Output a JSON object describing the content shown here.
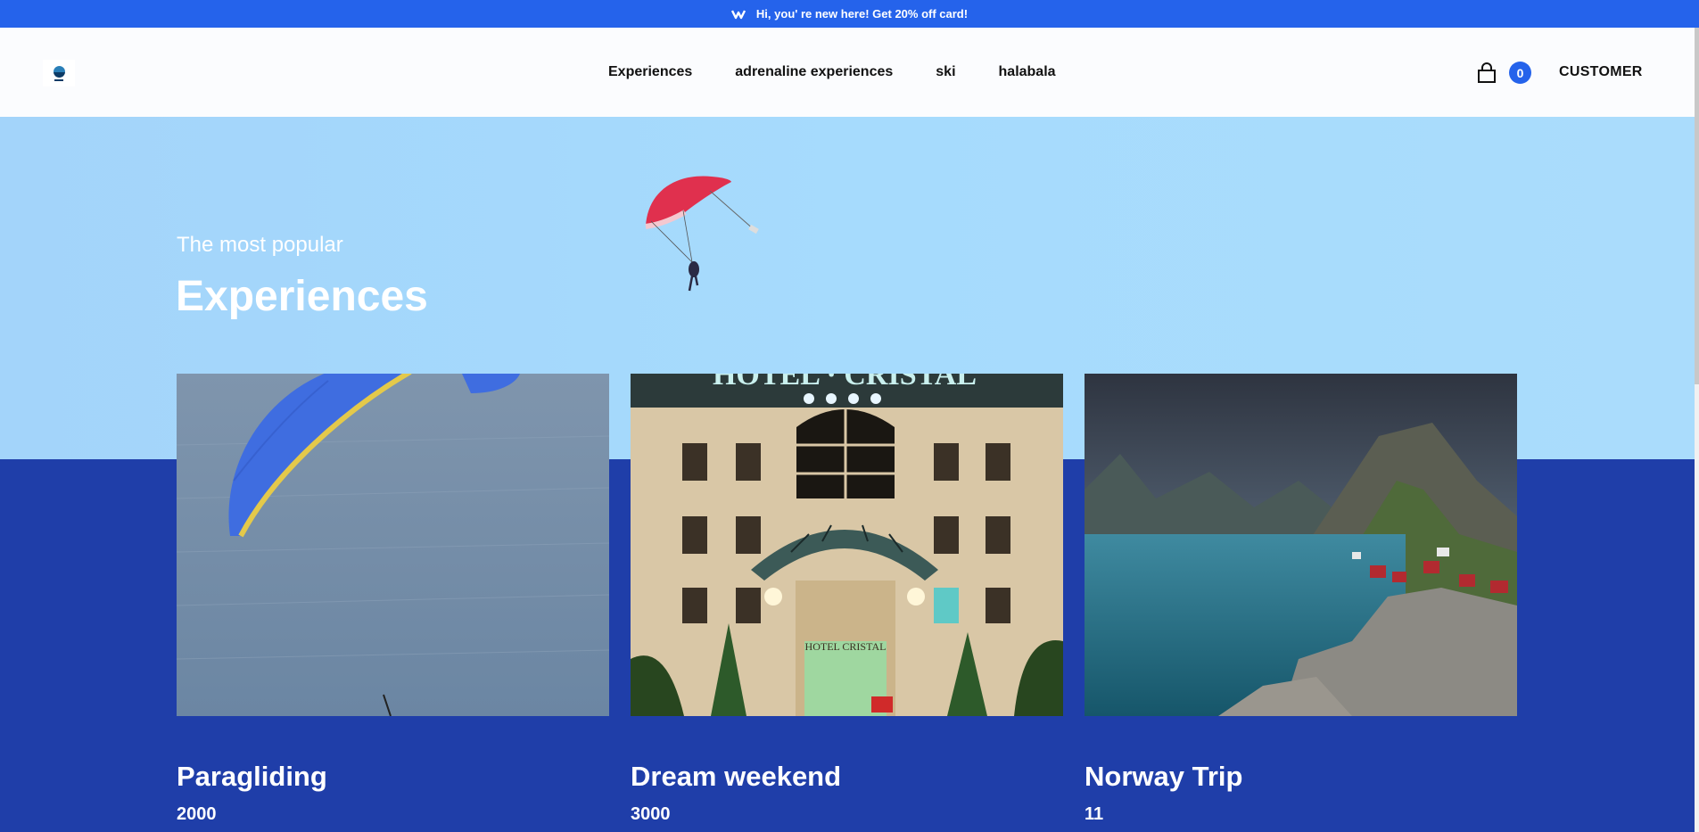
{
  "announcement": {
    "text": "Hi, you' re new here! Get 20% off card!"
  },
  "nav": {
    "items": [
      {
        "label": "Experiences"
      },
      {
        "label": "adrenaline experiences"
      },
      {
        "label": "ski"
      },
      {
        "label": "halabala"
      }
    ]
  },
  "cart": {
    "count": "0"
  },
  "account": {
    "label": "CUSTOMER"
  },
  "hero": {
    "subtitle": "The most popular",
    "title": "Experiences"
  },
  "cards": [
    {
      "title": "Paragliding",
      "price": "2000"
    },
    {
      "title": "Dream weekend",
      "price": "3000"
    },
    {
      "title": "Norway Trip",
      "price": "11"
    }
  ],
  "colors": {
    "primary": "#2563eb",
    "section_dark": "#1f3ea9",
    "sky": "#a6dbfd"
  }
}
